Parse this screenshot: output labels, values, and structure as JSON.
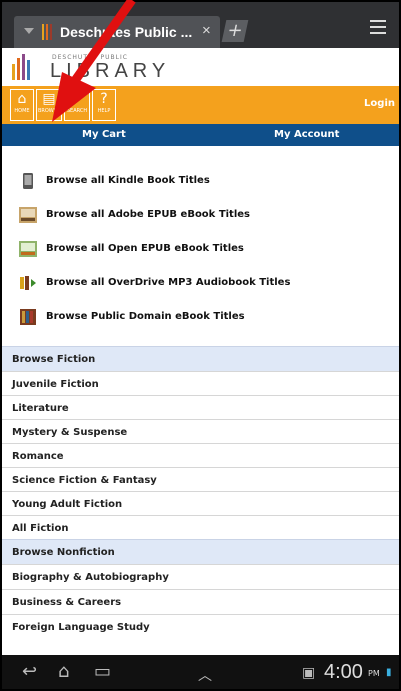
{
  "browser": {
    "tab_title": "Deschutes Public ...",
    "close_glyph": "×",
    "new_tab_glyph": "+",
    "menu_icon": "menu-icon"
  },
  "logo": {
    "small_text": "DESCHUTES PUBLIC",
    "big_text": "LIBRARY"
  },
  "toolbar": {
    "home_label": "HOME",
    "browse_label": "BROWSE",
    "search_label": "SEARCH",
    "help_label": "HELP",
    "login_label": "Login"
  },
  "account_bar": {
    "cart_label": "My Cart",
    "account_label": "My Account"
  },
  "book_types": [
    {
      "label": "Browse all Kindle Book Titles",
      "icon": "kindle-icon"
    },
    {
      "label": "Browse all Adobe EPUB eBook Titles",
      "icon": "adobe-epub-icon"
    },
    {
      "label": "Browse all Open EPUB eBook Titles",
      "icon": "open-epub-icon"
    },
    {
      "label": "Browse all OverDrive MP3 Audiobook Titles",
      "icon": "mp3-audiobook-icon"
    },
    {
      "label": "Browse Public Domain eBook Titles",
      "icon": "public-domain-icon"
    }
  ],
  "fiction": {
    "header": "Browse Fiction",
    "items": [
      "Juvenile Fiction",
      "Literature",
      "Mystery & Suspense",
      "Romance",
      "Science Fiction & Fantasy",
      "Young Adult Fiction",
      "All Fiction"
    ]
  },
  "nonfiction": {
    "header": "Browse Nonfiction",
    "items": [
      "Biography & Autobiography",
      "Business & Careers",
      "Foreign Language Study"
    ]
  },
  "status_bar": {
    "time": "4:00",
    "ampm": "PM"
  },
  "colors": {
    "orange": "#f4a11d",
    "blue": "#0f4f8a",
    "section_bg": "#dfe8f7",
    "annotation_arrow": "#e01010"
  }
}
